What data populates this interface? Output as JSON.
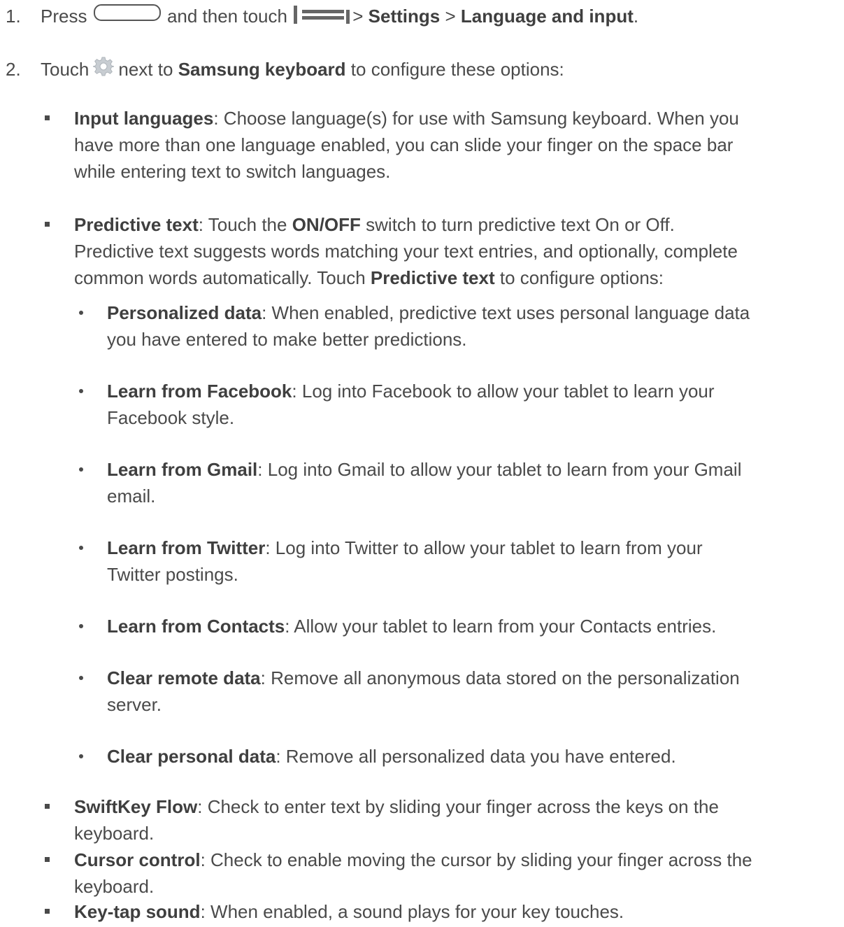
{
  "steps": [
    {
      "number": "1.",
      "press": "Press",
      "then_touch": "and then touch",
      "sep1": ">",
      "settings": "Settings",
      "sep2": ">",
      "language_input": "Language and input",
      "end": "."
    },
    {
      "number": "2.",
      "touch": "Touch",
      "next_to": "next to",
      "samsung_keyboard": "Samsung keyboard",
      "rest": "to configure these options:"
    }
  ],
  "icons": {
    "home_button": "home-button-icon",
    "menu": "menu-icon",
    "settings_gear": "gear-icon"
  },
  "options": [
    {
      "term": "Input languages",
      "lines": [
        ": Choose language(s) for use with Samsung keyboard. When you",
        "have more than one language enabled, you can slide your finger on the space bar",
        "while entering text to switch languages."
      ]
    },
    {
      "term": "Predictive text",
      "line1_a": ": Touch the ",
      "line1_b": "ON/OFF",
      "line1_c": " switch to turn predictive text On or Off.",
      "line2": "Predictive text suggests words matching your text entries, and optionally, complete",
      "line3_a": "common words automatically. Touch ",
      "line3_b": "Predictive text",
      "line3_c": " to configure options:"
    },
    {
      "term": "SwiftKey Flow",
      "lines": [
        ": Check to enter text by sliding your finger across the keys on the",
        "keyboard."
      ]
    },
    {
      "term": "Cursor control",
      "lines": [
        ": Check to enable moving the cursor by sliding your finger across the",
        "keyboard."
      ]
    },
    {
      "term": "Key-tap sound",
      "lines": [
        ": When enabled, a sound plays for your key touches."
      ]
    }
  ],
  "predictive_suboptions": [
    {
      "term": "Personalized data",
      "lines": [
        ": When enabled, predictive text uses personal language data",
        "you have entered to make better predictions."
      ]
    },
    {
      "term": "Learn from Facebook",
      "lines": [
        ": Log into Facebook to allow your tablet to learn your",
        "Facebook style."
      ]
    },
    {
      "term": "Learn from Gmail",
      "lines": [
        ": Log into Gmail to allow your tablet to learn from your Gmail",
        "email."
      ]
    },
    {
      "term": "Learn from Twitter",
      "lines": [
        ": Log into Twitter to allow your tablet to learn from your",
        "Twitter postings."
      ]
    },
    {
      "term": "Learn from Contacts",
      "lines": [
        ": Allow your tablet to learn from your Contacts entries."
      ]
    },
    {
      "term": "Clear remote data",
      "lines": [
        ": Remove all anonymous data stored on the personalization",
        "server."
      ]
    },
    {
      "term": "Clear personal data",
      "lines": [
        ": Remove all personalized data you have entered."
      ]
    }
  ]
}
